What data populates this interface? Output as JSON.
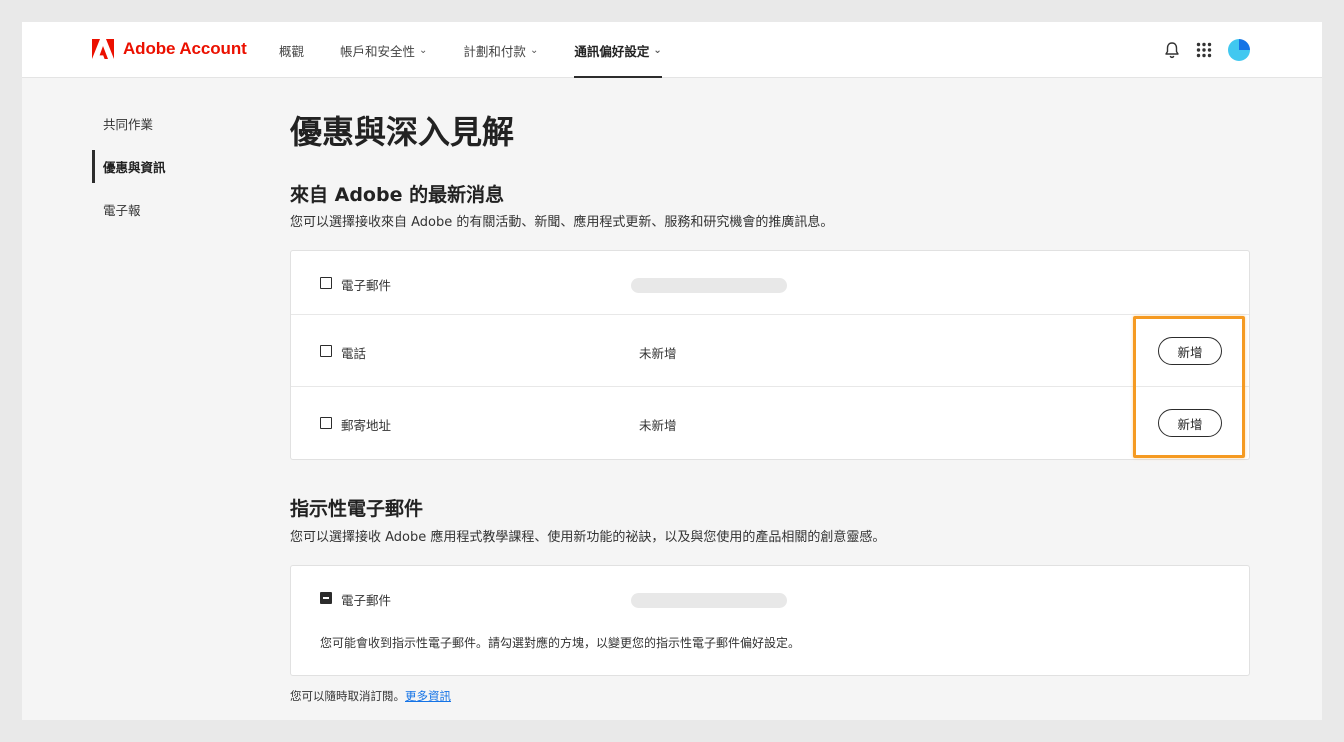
{
  "header": {
    "brand": "Adobe Account",
    "brand_color": "#eb1000",
    "nav": [
      {
        "label": "概觀",
        "dropdown": false,
        "active": false
      },
      {
        "label": "帳戶和安全性",
        "dropdown": true,
        "active": false
      },
      {
        "label": "計劃和付款",
        "dropdown": true,
        "active": false
      },
      {
        "label": "通訊偏好設定",
        "dropdown": true,
        "active": true
      }
    ],
    "icons": [
      "bell-icon",
      "app-grid-icon",
      "avatar"
    ]
  },
  "sidebar": {
    "items": [
      {
        "label": "共同作業",
        "active": false
      },
      {
        "label": "優惠與資訊",
        "active": true
      },
      {
        "label": "電子報",
        "active": false
      }
    ]
  },
  "main": {
    "title": "優惠與深入見解",
    "adobe_news": {
      "title": "來自 Adobe 的最新消息",
      "description": "您可以選擇接收來自 Adobe 的有關活動、新聞、應用程式更新、服務和研究機會的推廣訊息。",
      "rows": [
        {
          "label": "電子郵件",
          "checked": false
        },
        {
          "label": "電話",
          "value": "未新增",
          "button": "新增",
          "checked": false
        },
        {
          "label": "郵寄地址",
          "value": "未新增",
          "button": "新增",
          "checked": false
        }
      ]
    },
    "guided_email": {
      "title": "指示性電子郵件",
      "description": "您可以選擇接收 Adobe 應用程式教學課程、使用新功能的祕訣，以及與您使用的產品相關的創意靈感。",
      "row_label": "電子郵件",
      "state": "mixed",
      "note": "您可能會收到指示性電子郵件。請勾選對應的方塊，以變更您的指示性電子郵件偏好設定。"
    },
    "footer": {
      "text": "您可以隨時取消訂閱。",
      "link": "更多資訊"
    }
  },
  "highlight_color": "#f59a21"
}
